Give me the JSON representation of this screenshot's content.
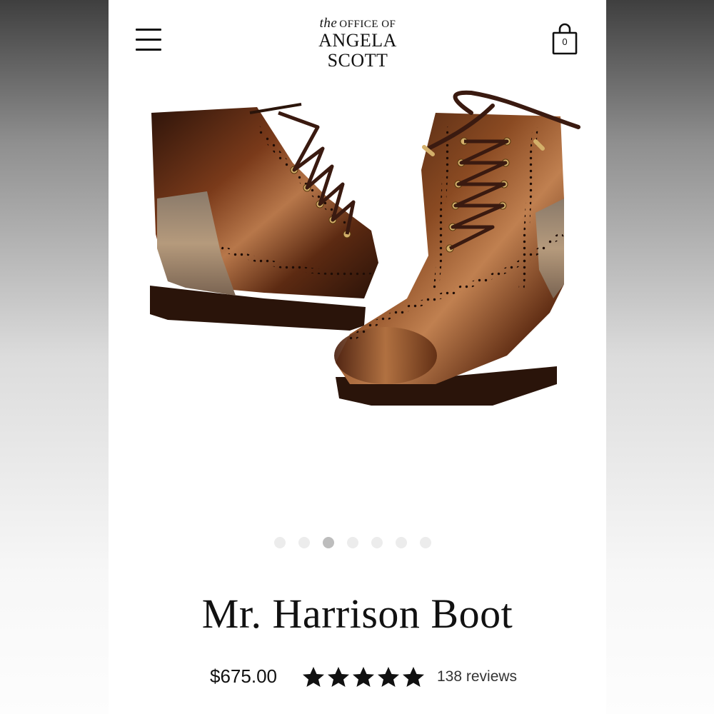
{
  "header": {
    "brand_small": "OFFICE OF",
    "brand_the": "the",
    "brand_main": "ANGELA SCOTT",
    "bag_count": "0",
    "menu_icon": "hamburger-menu-icon",
    "bag_icon": "shopping-bag-icon"
  },
  "gallery": {
    "image_subject": "pair of brown leather wingtip lace-up boots",
    "slide_count": 7,
    "active_slide": 3
  },
  "product": {
    "title": "Mr. Harrison Boot",
    "price": "$675.00",
    "rating": 5,
    "reviews": "138 reviews"
  },
  "colors": {
    "text": "#111111",
    "dot_inactive": "#ececec",
    "dot_active": "#bdbdbd",
    "leather_dark": "#3a1c10",
    "leather_mid": "#6b3418",
    "leather_light": "#a86a3a"
  }
}
